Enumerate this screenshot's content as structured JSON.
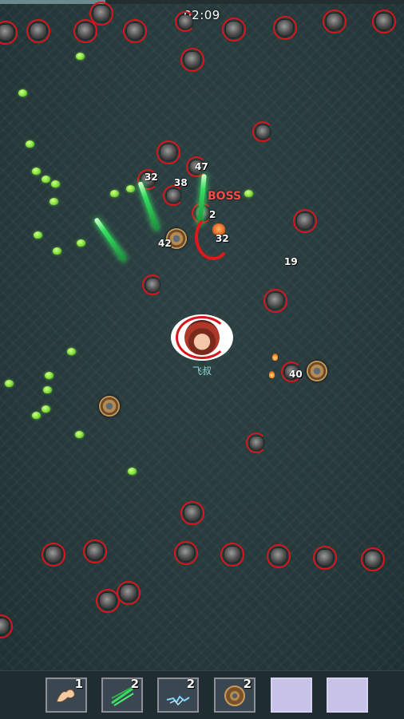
{
  "hud": {
    "timer": "02:09",
    "progress_fraction": 0.26
  },
  "player": {
    "name": "飞叔"
  },
  "boss": {
    "label": "BOSS"
  },
  "damage_numbers": [
    "47",
    "32",
    "38",
    "32",
    "42",
    "19",
    "40",
    "2"
  ],
  "toolbar": {
    "slots": [
      {
        "icon": "muscle-arm-icon",
        "level": "1"
      },
      {
        "icon": "green-sword-icon",
        "level": "2"
      },
      {
        "icon": "blue-lightning-icon",
        "level": "2"
      },
      {
        "icon": "bronze-wheel-icon",
        "level": "2"
      },
      {
        "icon": "",
        "level": ""
      },
      {
        "icon": "",
        "level": ""
      }
    ]
  },
  "colors": {
    "background": "#2a3b3d",
    "enemy_ring": "#d8161c",
    "gem": "#7ee03a",
    "boss_text": "#ff4a4a",
    "player_name": "#8ed6d2",
    "empty_slot": "#c9c2e8"
  }
}
